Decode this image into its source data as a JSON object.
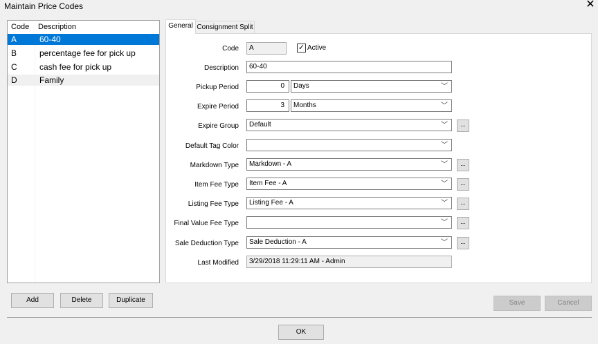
{
  "window": {
    "title": "Maintain Price Codes",
    "close_glyph": "✕"
  },
  "list": {
    "headers": {
      "code": "Code",
      "description": "Description"
    },
    "rows": [
      {
        "code": "A",
        "description": "60-40"
      },
      {
        "code": "B",
        "description": "percentage fee for pick up"
      },
      {
        "code": "C",
        "description": "cash fee for pick up"
      },
      {
        "code": "D",
        "description": "Family"
      }
    ],
    "selected_index": 0
  },
  "list_buttons": {
    "add": "Add",
    "delete": "Delete",
    "duplicate": "Duplicate"
  },
  "tabs": [
    {
      "label": "General"
    },
    {
      "label": "Consignment Split"
    }
  ],
  "form": {
    "code": {
      "label": "Code",
      "value": "A"
    },
    "active": {
      "label": "Active",
      "checked": true,
      "mark": "✓"
    },
    "description": {
      "label": "Description",
      "value": "60-40"
    },
    "pickup_period": {
      "label": "Pickup Period",
      "number": "0",
      "unit": "Days"
    },
    "expire_period": {
      "label": "Expire Period",
      "number": "3",
      "unit": "Months"
    },
    "expire_group": {
      "label": "Expire Group",
      "value": "Default"
    },
    "default_tag_color": {
      "label": "Default Tag Color",
      "value": ""
    },
    "markdown_type": {
      "label": "Markdown Type",
      "value": "Markdown - A"
    },
    "item_fee_type": {
      "label": "Item Fee Type",
      "value": "Item Fee - A"
    },
    "listing_fee_type": {
      "label": "Listing Fee Type",
      "value": "Listing Fee - A"
    },
    "final_value_fee_type": {
      "label": "Final Value Fee Type",
      "value": ""
    },
    "sale_deduction_type": {
      "label": "Sale Deduction Type",
      "value": "Sale Deduction - A"
    },
    "last_modified": {
      "label": "Last Modified",
      "value": "3/29/2018 11:29:11 AM - Admin"
    },
    "ellipsis": "..."
  },
  "actions": {
    "save": "Save",
    "cancel": "Cancel",
    "ok": "OK"
  }
}
